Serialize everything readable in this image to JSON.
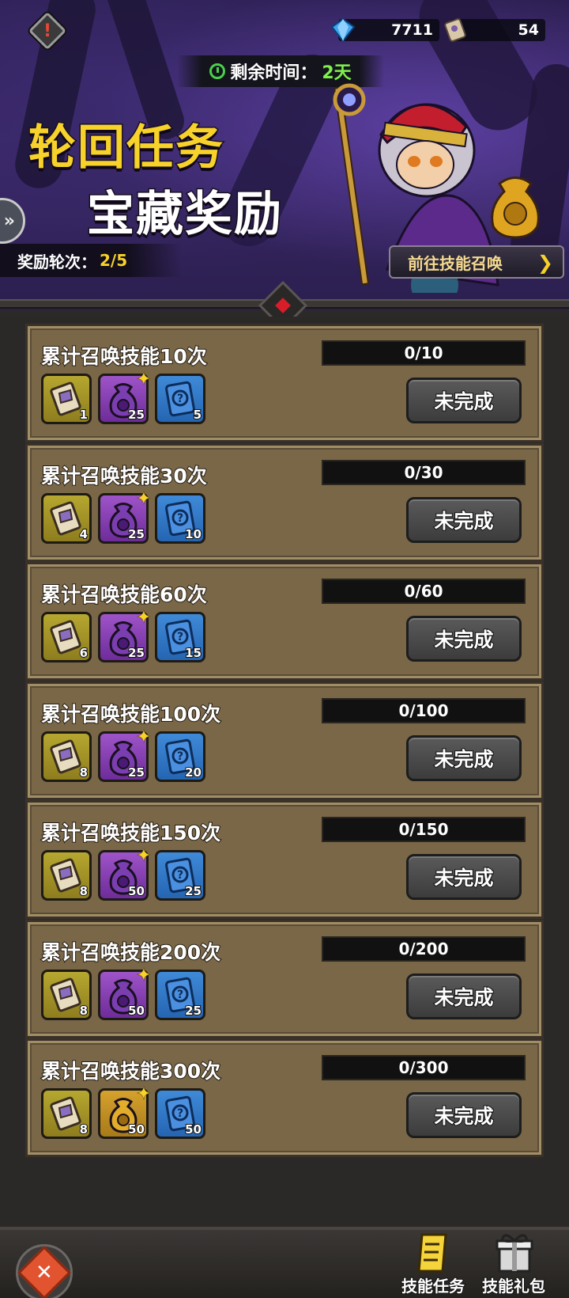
{
  "header": {
    "currency": [
      {
        "icon": "diamond-icon",
        "value": "7711"
      },
      {
        "icon": "scroll-icon",
        "value": "54"
      }
    ],
    "timer": {
      "label": "剩余时间：",
      "value": "2天"
    },
    "title_line1": "轮回任务",
    "title_line2": "宝藏奖励",
    "round": {
      "label": "奖励轮次：",
      "value": "2/5"
    },
    "goto_button": "前往技能召唤"
  },
  "quests": [
    {
      "title": "累计召唤技能10次",
      "progress": "0/10",
      "status": "未完成",
      "rewards": [
        {
          "type": "scroll",
          "count": "1"
        },
        {
          "type": "purple-bag",
          "count": "25"
        },
        {
          "type": "blue-card",
          "count": "5"
        }
      ]
    },
    {
      "title": "累计召唤技能30次",
      "progress": "0/30",
      "status": "未完成",
      "rewards": [
        {
          "type": "scroll",
          "count": "4"
        },
        {
          "type": "purple-bag",
          "count": "25"
        },
        {
          "type": "blue-card",
          "count": "10"
        }
      ]
    },
    {
      "title": "累计召唤技能60次",
      "progress": "0/60",
      "status": "未完成",
      "rewards": [
        {
          "type": "scroll",
          "count": "6"
        },
        {
          "type": "purple-bag",
          "count": "25"
        },
        {
          "type": "blue-card",
          "count": "15"
        }
      ]
    },
    {
      "title": "累计召唤技能100次",
      "progress": "0/100",
      "status": "未完成",
      "rewards": [
        {
          "type": "scroll",
          "count": "8"
        },
        {
          "type": "purple-bag",
          "count": "25"
        },
        {
          "type": "blue-card",
          "count": "20"
        }
      ]
    },
    {
      "title": "累计召唤技能150次",
      "progress": "0/150",
      "status": "未完成",
      "rewards": [
        {
          "type": "scroll",
          "count": "8"
        },
        {
          "type": "purple-bag",
          "count": "50"
        },
        {
          "type": "blue-card",
          "count": "25"
        }
      ]
    },
    {
      "title": "累计召唤技能200次",
      "progress": "0/200",
      "status": "未完成",
      "rewards": [
        {
          "type": "scroll",
          "count": "8"
        },
        {
          "type": "purple-bag",
          "count": "50"
        },
        {
          "type": "blue-card",
          "count": "25"
        }
      ]
    },
    {
      "title": "累计召唤技能300次",
      "progress": "0/300",
      "status": "未完成",
      "rewards": [
        {
          "type": "scroll",
          "count": "8"
        },
        {
          "type": "gold-bag",
          "count": "50"
        },
        {
          "type": "blue-card",
          "count": "50"
        }
      ]
    }
  ],
  "footer": {
    "tab_quest": "技能任务",
    "tab_gift": "技能礼包"
  },
  "colors": {
    "accent_yellow": "#f7d22a",
    "timer_green": "#7ef04a",
    "card_bg": "#796748",
    "close_orange": "#e25430"
  }
}
